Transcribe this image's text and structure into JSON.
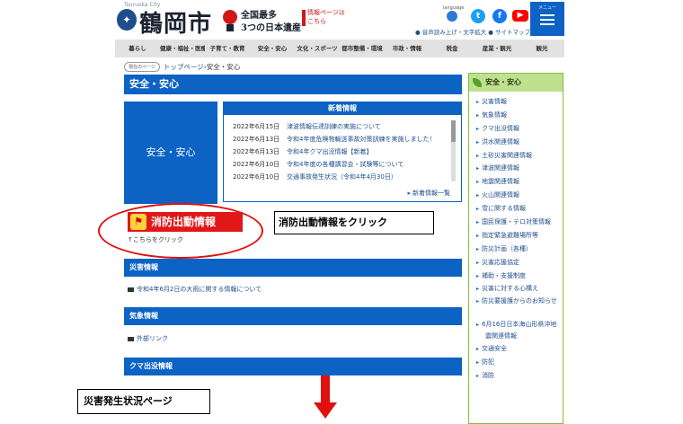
{
  "header": {
    "logo_small": "Tsuruoka City",
    "logo_text": "鶴岡市",
    "heritage_line1": "全国最多",
    "heritage_line2": "3つの日本遺産",
    "info_text": "情報ページは こちら",
    "language_label": "language",
    "sub_links": "● 音声読み上げ・文字拡大 ● サイトマップ",
    "menu_label": "メニュー",
    "icons": {
      "logo": "city-emblem-icon",
      "twitter": "twitter-icon",
      "facebook": "facebook-icon",
      "youtube": "youtube-icon",
      "language": "globe-icon",
      "menu": "hamburger-icon"
    }
  },
  "nav": [
    "暮らし",
    "健康・福祉・医療",
    "子育て・教育",
    "安全・安心",
    "文化・スポーツ",
    "都市整備・環境",
    "市政・情報",
    "税金",
    "産業・観光",
    "観光"
  ],
  "breadcrumb": {
    "pill": "現在のページ",
    "home": "トップページ",
    "sep": " › ",
    "current": "安全・安心"
  },
  "page_title": "安全・安心",
  "safety_box": "安全・安心",
  "news": {
    "header": "新着情報",
    "items": [
      {
        "date": "2022年6月15日",
        "title": "津波情報伝達訓練の実施について"
      },
      {
        "date": "2022年6月13日",
        "title": "令和4年度危険物輸送事故対策訓練を実施しました！"
      },
      {
        "date": "2022年6月13日",
        "title": "令和4年クマ出没情報【新着】"
      },
      {
        "date": "2022年6月10日",
        "title": "令和4年度の各種講習会・試験等について"
      },
      {
        "date": "2022年6月10日",
        "title": "交通事故発生状況（令和4年4月30日）"
      }
    ],
    "more": "新着情報一覧"
  },
  "fire": {
    "banner": "消防出動情報",
    "click_here": "↑こちらをクリック",
    "callout": "消防出動情報をクリック"
  },
  "sections": [
    {
      "title": "災害情報",
      "link": "令和4年6月2日の大雨に関する情報について"
    },
    {
      "title": "気象情報",
      "link": "外部リンク"
    },
    {
      "title": "クマ出没情報",
      "link": ""
    }
  ],
  "sidebar": {
    "title": "安全・安心",
    "items": [
      "災害情報",
      "気象情報",
      "クマ出没情報",
      "洪水関連情報",
      "土砂災害関連情報",
      "津波関連情報",
      "地震関連情報",
      "火山関連情報",
      "雪に関する情報",
      "国民保護・テロ対策情報",
      "指定緊急避難場所等",
      "防災計画（各種）",
      "災害応援協定",
      "補助・支援制度",
      "災害に対する心構え",
      "防災要援護からのお知らせ",
      "6月16日日本海山形県沖地震関連情報",
      "交通安全",
      "防犯",
      "消防"
    ]
  },
  "annotation": {
    "bottom_label": "災害発生状況ページ"
  },
  "colors": {
    "primary": "#0c63c4",
    "accent_red": "#e01010",
    "sidebar_green": "#bfe08f"
  }
}
